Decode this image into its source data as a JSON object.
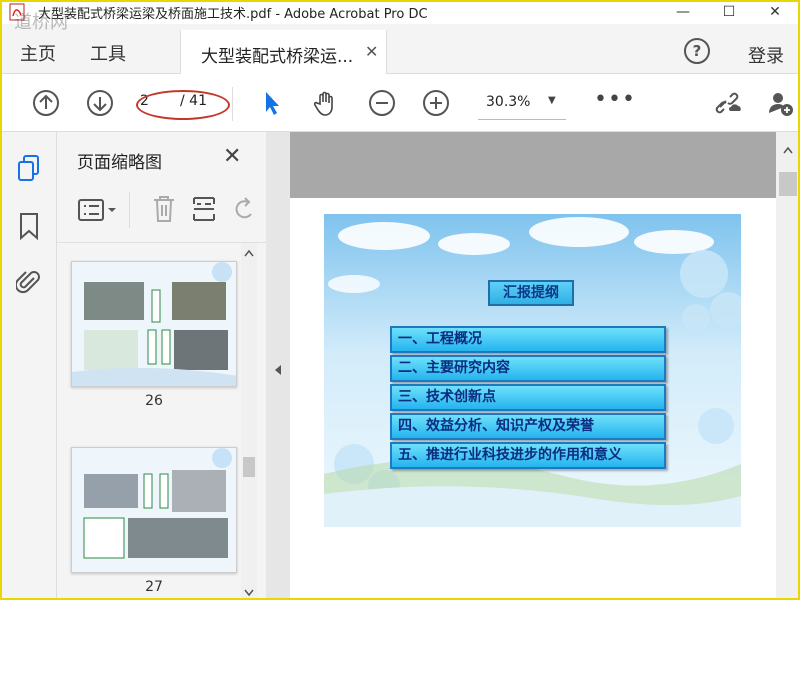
{
  "window": {
    "title": "大型装配式桥梁运梁及桥面施工技术.pdf - Adobe Acrobat Pro DC",
    "watermark": "道桥网",
    "controls": {
      "minimize": "—",
      "maximize": "☐",
      "close": "✕"
    }
  },
  "menubar": {
    "home": "主页",
    "tools": "工具",
    "doc_tab_label": "大型装配式桥梁运...",
    "doc_tab_close": "✕",
    "help": "?",
    "login": "登录"
  },
  "toolbar": {
    "page_current": "2",
    "page_total": "/ 41",
    "zoom": "30.3%",
    "zoom_arrow": "▼",
    "more": "•••"
  },
  "thumb_panel": {
    "title": "页面缩略图",
    "close": "✕",
    "thumbnails": [
      {
        "label": "26"
      },
      {
        "label": "27"
      }
    ]
  },
  "slide": {
    "title": "汇报提纲",
    "items": [
      "一、工程概况",
      "二、主要研究内容",
      "三、技术创新点",
      "四、效益分析、知识产权及荣誉",
      "五、推进行业科技进步的作用和意义"
    ]
  },
  "colors": {
    "accent_blue": "#1473e6",
    "highlight_ellipse": "#c0392b",
    "frame": "#e8d800"
  }
}
